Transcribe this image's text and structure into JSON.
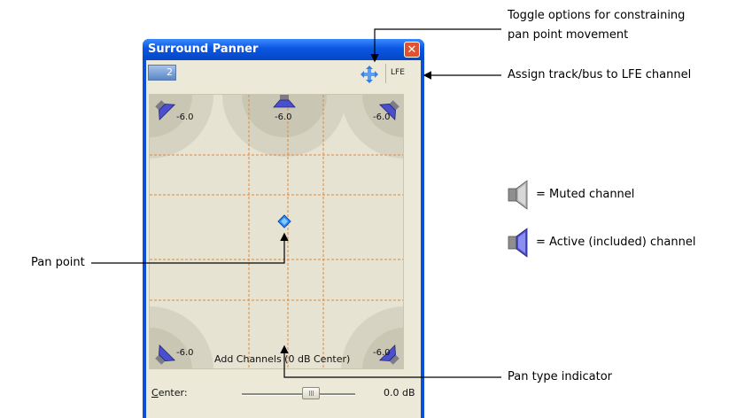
{
  "window": {
    "title": "Surround Panner",
    "channel_count": "2",
    "lfe_label": "LFE",
    "close_glyph": "✕"
  },
  "speakers": {
    "front_left_db": "-6.0",
    "center_db": "-6.0",
    "front_right_db": "-6.0",
    "rear_left_db": "-6.0",
    "rear_right_db": "-6.0"
  },
  "pan_type": "Add Channels (0 dB Center)",
  "center_control": {
    "label_accel": "C",
    "label_rest": "enter:",
    "value": "0.0 dB"
  },
  "callouts": {
    "constrain_line1": "Toggle options for constraining",
    "constrain_line2": "pan point movement",
    "lfe": "Assign track/bus to LFE channel",
    "pan_point": "Pan point",
    "pan_type": "Pan type indicator"
  },
  "legend": {
    "muted": "= Muted channel",
    "active": "= Active (included) channel"
  },
  "colors": {
    "title_bar": "#0a55e0",
    "panner_bg": "#e6e3d2",
    "grid_line": "#e08a3c",
    "pan_point": "#2a8ef0",
    "speaker_active": "#4a4fd0",
    "speaker_muted": "#9c9c9c"
  }
}
